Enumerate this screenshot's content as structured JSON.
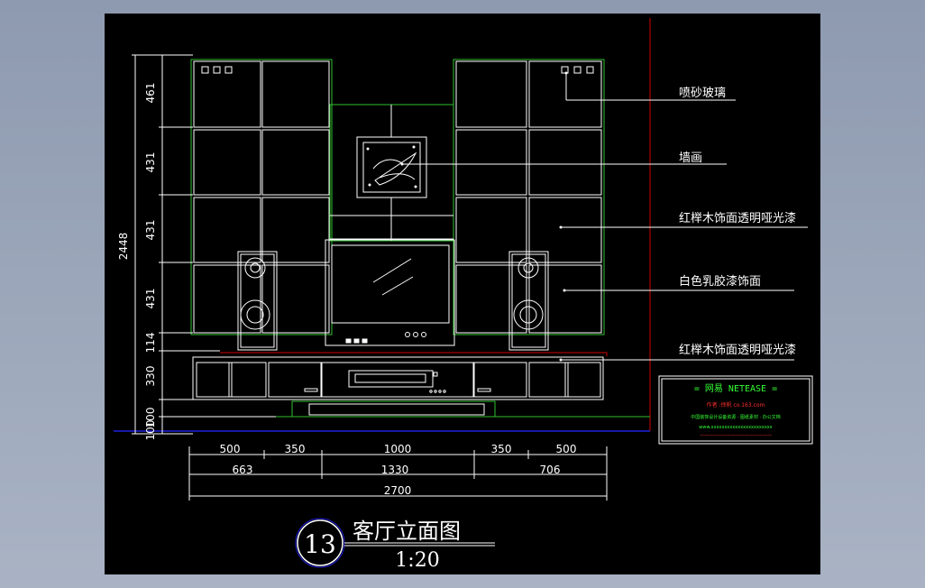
{
  "drawing": {
    "annotations": {
      "frosted_glass": "喷砂玻璃",
      "wall_painting": "墙画",
      "birch_veneer_upper": "红榉木饰面透明哑光漆",
      "white_latex": "白色乳胶漆饰面",
      "birch_veneer_lower": "红榉木饰面透明哑光漆"
    },
    "dims_vertical": {
      "total": "2448",
      "seg1": "461",
      "seg2": "431",
      "seg3": "431",
      "seg4": "431",
      "seg5": "114",
      "seg6": "330",
      "seg7": "100",
      "seg8": "100"
    },
    "dims_horizontal": {
      "row1": [
        "500",
        "350",
        "1000",
        "350",
        "500"
      ],
      "row2": [
        "663",
        "1330",
        "706"
      ],
      "row3": "2700"
    },
    "title_block": {
      "number": "13",
      "title": "客厅立面图",
      "scale": "1:20"
    },
    "stamp": {
      "heading": "= 网易  NETEASE =",
      "line1": "作者 :徐帆 co.163.com",
      "line2": "中国装饰设计设备资源 · 图纸素材 · 办公文档",
      "line3": "www.xxxxxxxxxxxxxxxxxxxxxxx",
      "line4": "————————————————"
    },
    "colors": {
      "background": "#000000",
      "lines": "#ffffff",
      "green_outline": "#2fbf2f",
      "red_line": "#d00000",
      "blue_line": "#2020e0",
      "stamp_text": "#33ff33",
      "stamp_red": "#ff3030"
    }
  }
}
